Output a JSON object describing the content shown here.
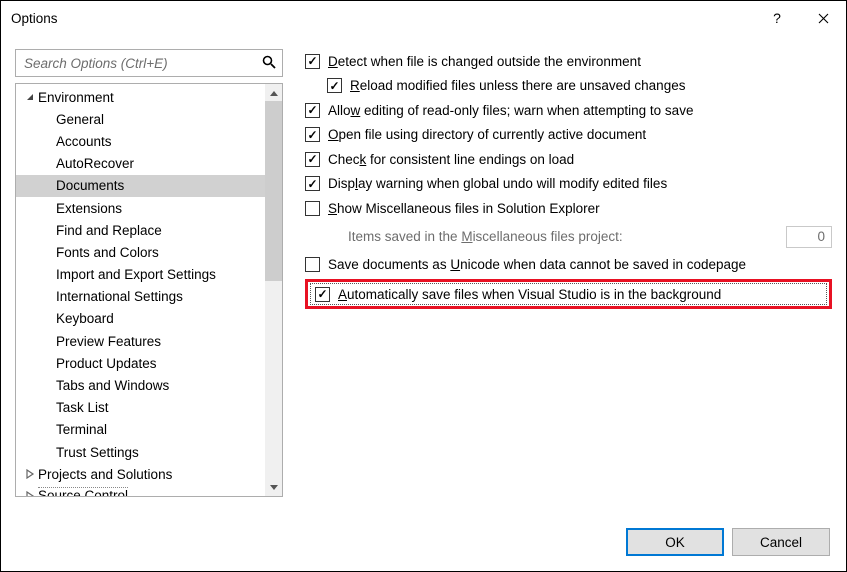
{
  "window": {
    "title": "Options"
  },
  "search": {
    "placeholder": "Search Options (Ctrl+E)"
  },
  "tree": {
    "items": [
      {
        "label": "Environment",
        "level": 0,
        "expanded": true
      },
      {
        "label": "General",
        "level": 1
      },
      {
        "label": "Accounts",
        "level": 1
      },
      {
        "label": "AutoRecover",
        "level": 1
      },
      {
        "label": "Documents",
        "level": 1,
        "selected": true
      },
      {
        "label": "Extensions",
        "level": 1
      },
      {
        "label": "Find and Replace",
        "level": 1
      },
      {
        "label": "Fonts and Colors",
        "level": 1
      },
      {
        "label": "Import and Export Settings",
        "level": 1
      },
      {
        "label": "International Settings",
        "level": 1
      },
      {
        "label": "Keyboard",
        "level": 1
      },
      {
        "label": "Preview Features",
        "level": 1
      },
      {
        "label": "Product Updates",
        "level": 1
      },
      {
        "label": "Tabs and Windows",
        "level": 1
      },
      {
        "label": "Task List",
        "level": 1
      },
      {
        "label": "Terminal",
        "level": 1
      },
      {
        "label": "Trust Settings",
        "level": 1
      },
      {
        "label": "Projects and Solutions",
        "level": 0,
        "expanded": false
      },
      {
        "label": "Source Control",
        "level": 0,
        "expanded": false,
        "cut": true
      }
    ]
  },
  "options": {
    "detect": {
      "checked": true,
      "html": "<u>D</u>etect when file is changed outside the environment"
    },
    "reload": {
      "checked": true,
      "html": "<u>R</u>eload modified files unless there are unsaved changes"
    },
    "allow_ro": {
      "checked": true,
      "html": "Allo<u>w</u> editing of read-only files; warn when attempting to save"
    },
    "open_dir": {
      "checked": true,
      "html": "<u>O</u>pen file using directory of currently active document"
    },
    "check_eol": {
      "checked": true,
      "html": "Chec<u>k</u> for consistent line endings on load"
    },
    "undo_warn": {
      "checked": true,
      "html": "Disp<u>l</u>ay warning when global undo will modify edited files"
    },
    "show_misc": {
      "checked": false,
      "html": "<u>S</u>how Miscellaneous files in Solution Explorer"
    },
    "misc_count": {
      "html": "Items saved in the <u>M</u>iscellaneous files project:",
      "value": "0"
    },
    "save_unicode": {
      "checked": false,
      "html": "Save documents as <u>U</u>nicode when data cannot be saved in codepage"
    },
    "autosave_bg": {
      "checked": true,
      "html": "<u>A</u>utomatically save files when Visual Studio is in the background"
    }
  },
  "buttons": {
    "ok": "OK",
    "cancel": "Cancel"
  }
}
